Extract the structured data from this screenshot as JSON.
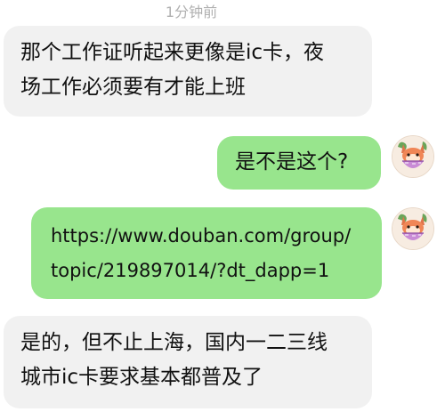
{
  "chat": {
    "timestamp": "1分钟前",
    "messages": [
      {
        "side": "left",
        "lines": [
          "那个工作证听起来更像是ic卡，夜",
          "场工作必须要有才能上班"
        ]
      },
      {
        "side": "right",
        "lines": [
          "是不是这个?"
        ],
        "avatar_icon": "fox-cat-avatar-icon"
      },
      {
        "side": "right",
        "lines": [
          "https://www.douban.com/group/",
          "topic/219897014/?dt_dapp=1"
        ],
        "avatar_icon": "fox-cat-avatar-icon"
      },
      {
        "side": "left",
        "lines": [
          "是的，但不止上海，国内一二三线",
          "城市ic卡要求基本都普及了"
        ]
      }
    ]
  },
  "colors": {
    "incoming_bubble": "#f1f1f1",
    "outgoing_bubble": "#98e58d",
    "timestamp_text": "#b0b0b0",
    "message_text": "#111111"
  }
}
